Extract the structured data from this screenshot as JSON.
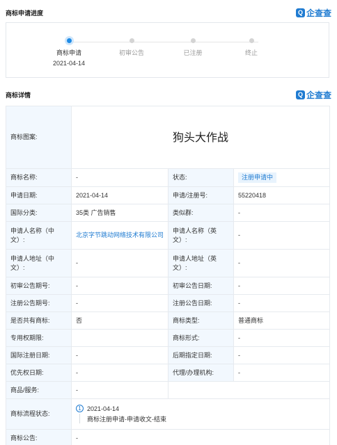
{
  "progress": {
    "title": "商标申请进度",
    "brand": "企查查",
    "steps": [
      {
        "label": "商标申请",
        "date": "2021-04-14",
        "active": true
      },
      {
        "label": "初审公告",
        "date": "",
        "active": false
      },
      {
        "label": "已注册",
        "date": "",
        "active": false
      },
      {
        "label": "终止",
        "date": "",
        "active": false
      }
    ]
  },
  "detail": {
    "title": "商标详情",
    "brand": "企查查",
    "image_label": "商标图案:",
    "image_text": "狗头大作战",
    "rows": [
      {
        "k1": "商标名称:",
        "v1": "-",
        "k2": "状态:",
        "v2": "注册申请中"
      },
      {
        "k1": "申请日期:",
        "v1": "2021-04-14",
        "k2": "申请/注册号:",
        "v2": "55220418"
      },
      {
        "k1": "国际分类:",
        "v1": "35类 广告销售",
        "k2": "类似群:",
        "v2": "-"
      },
      {
        "k1": "申请人名称（中文）:",
        "v1": "北京字节跳动网络技术有限公司",
        "k2": "申请人名称（英文）:",
        "v2": "-"
      },
      {
        "k1": "申请人地址（中文）:",
        "v1": "-",
        "k2": "申请人地址（英文）:",
        "v2": "-"
      },
      {
        "k1": "初审公告期号:",
        "v1": "-",
        "k2": "初审公告日期:",
        "v2": "-"
      },
      {
        "k1": "注册公告期号:",
        "v1": "-",
        "k2": "注册公告日期:",
        "v2": "-"
      },
      {
        "k1": "是否共有商标:",
        "v1": "否",
        "k2": "商标类型:",
        "v2": "普通商标"
      },
      {
        "k1": "专用权期限:",
        "v1": "",
        "k2": "商标形式:",
        "v2": "-"
      },
      {
        "k1": "国际注册日期:",
        "v1": "-",
        "k2": "后期指定日期:",
        "v2": "-"
      },
      {
        "k1": "优先权日期:",
        "v1": "-",
        "k2": "代理/办理机构:",
        "v2": "-"
      }
    ],
    "goods_label": "商品/服务:",
    "goods_value": "-",
    "flow_label": "商标流程状态:",
    "flow_num": "1",
    "flow_date": "2021-04-14",
    "flow_desc": "商标注册申请-申请收文-结束",
    "notice_label": "商标公告:",
    "notice_value": "-"
  }
}
